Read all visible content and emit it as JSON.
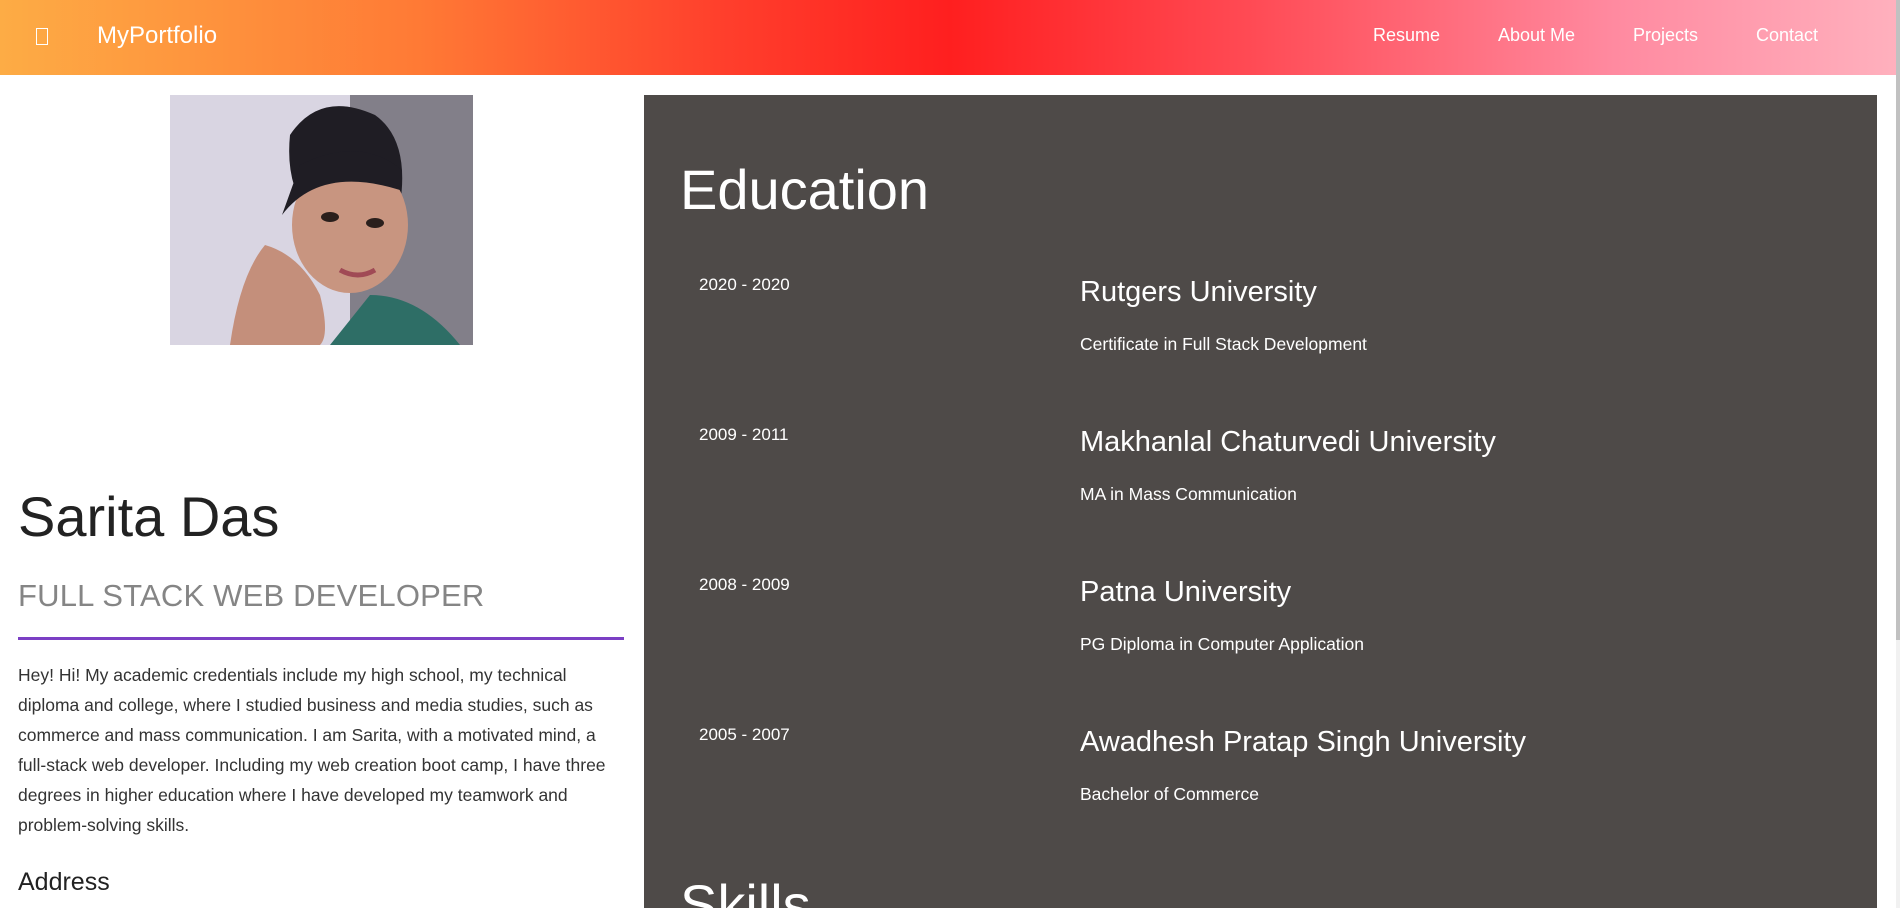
{
  "navbar": {
    "brand": "MyPortfolio",
    "icon": "book-icon",
    "links": [
      {
        "label": "Resume"
      },
      {
        "label": "About Me"
      },
      {
        "label": "Projects"
      },
      {
        "label": "Contact"
      }
    ]
  },
  "profile": {
    "name": "Sarita Das",
    "title": "FULL STACK WEB DEVELOPER",
    "bio": "Hey! Hi! My academic credentials include my high school, my technical diploma and college, where I studied business and media studies, such as commerce and mass communication. I am Sarita, with a motivated mind, a full-stack web developer. Including my web creation boot camp, I have three degrees in higher education where I have developed my teamwork and problem-solving skills.",
    "address_heading": "Address"
  },
  "education": {
    "heading": "Education",
    "items": [
      {
        "years": "2020 - 2020",
        "school": "Rutgers University",
        "degree": "Certificate in Full Stack Development"
      },
      {
        "years": "2009 - 2011",
        "school": "Makhanlal Chaturvedi University",
        "degree": "MA in Mass Communication"
      },
      {
        "years": "2008 - 2009",
        "school": "Patna University",
        "degree": "PG Diploma in Computer Application"
      },
      {
        "years": "2005 - 2007",
        "school": "Awadhesh Pratap Singh University",
        "degree": "Bachelor of Commerce"
      }
    ]
  },
  "skills": {
    "heading": "Skills"
  },
  "colors": {
    "panel_background": "#4e4a48",
    "divider": "#7b3fc4",
    "navbar_gradient_start": "#fdac45",
    "navbar_gradient_mid": "#ff1f1f",
    "navbar_gradient_end": "#ffb1be"
  }
}
